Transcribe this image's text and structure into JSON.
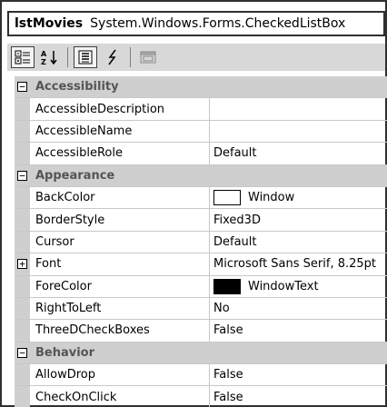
{
  "selector": {
    "object_name": "lstMovies",
    "object_type": "System.Windows.Forms.CheckedListBox"
  },
  "toolbar": {
    "buttons": [
      {
        "icon": "categorized-icon",
        "pressed": true
      },
      {
        "icon": "alphabetical-icon",
        "pressed": false
      },
      {
        "icon": "properties-icon",
        "pressed": true
      },
      {
        "icon": "events-icon",
        "pressed": false
      },
      {
        "icon": "property-pages-icon",
        "pressed": false
      }
    ]
  },
  "grid": {
    "rows": [
      {
        "kind": "category",
        "expander": "−",
        "name": "Accessibility"
      },
      {
        "kind": "prop",
        "name": "AccessibleDescription",
        "value": ""
      },
      {
        "kind": "prop",
        "name": "AccessibleName",
        "value": ""
      },
      {
        "kind": "prop",
        "name": "AccessibleRole",
        "value": "Default"
      },
      {
        "kind": "category",
        "expander": "−",
        "name": "Appearance"
      },
      {
        "kind": "prop",
        "name": "BackColor",
        "value": "Window",
        "swatch": "#ffffff"
      },
      {
        "kind": "prop",
        "name": "BorderStyle",
        "value": "Fixed3D"
      },
      {
        "kind": "prop",
        "name": "Cursor",
        "value": "Default"
      },
      {
        "kind": "prop",
        "name": "Font",
        "value": "Microsoft Sans Serif, 8.25pt",
        "expander": "+"
      },
      {
        "kind": "prop",
        "name": "ForeColor",
        "value": "WindowText",
        "swatch": "#000000"
      },
      {
        "kind": "prop",
        "name": "RightToLeft",
        "value": "No"
      },
      {
        "kind": "prop",
        "name": "ThreeDCheckBoxes",
        "value": "False"
      },
      {
        "kind": "category",
        "expander": "−",
        "name": "Behavior"
      },
      {
        "kind": "prop",
        "name": "AllowDrop",
        "value": "False"
      },
      {
        "kind": "prop",
        "name": "CheckOnClick",
        "value": "False"
      }
    ]
  }
}
